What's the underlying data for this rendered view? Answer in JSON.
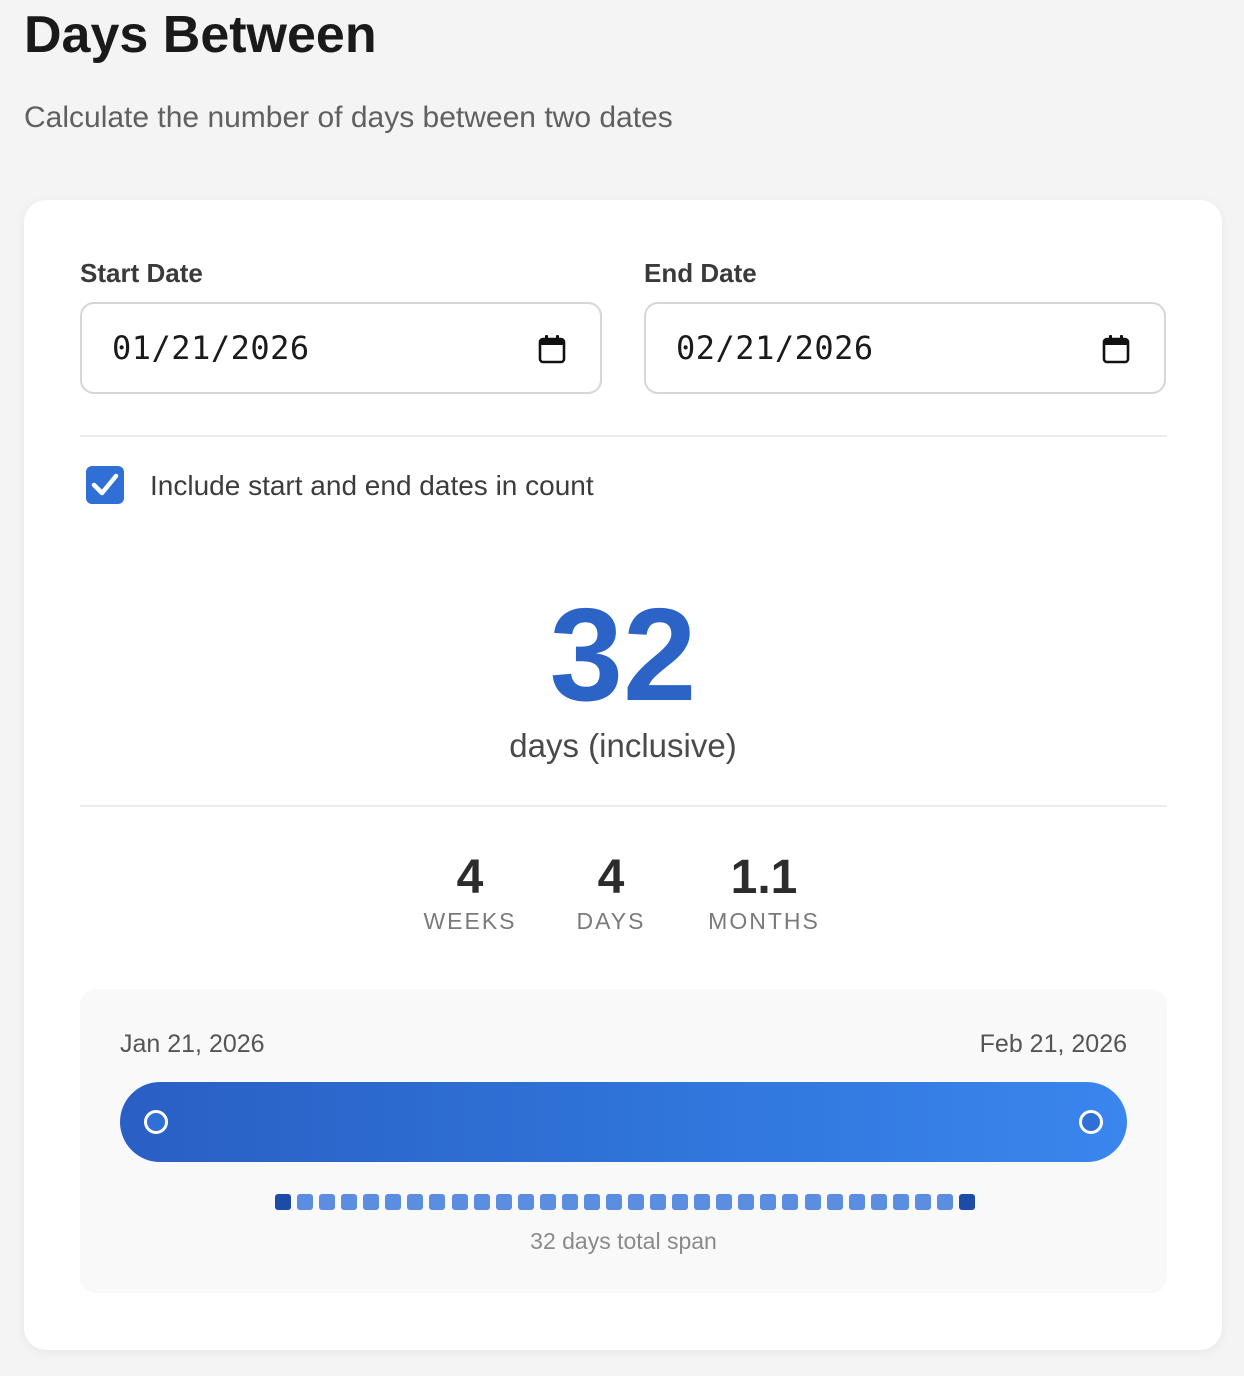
{
  "page": {
    "title": "Days Between",
    "subtitle": "Calculate the number of days between two dates"
  },
  "form": {
    "start_label": "Start Date",
    "start_value": "01/21/2026",
    "end_label": "End Date",
    "end_value": "02/21/2026",
    "calendar_icon": "calendar-icon"
  },
  "options": {
    "include_label": "Include start and end dates in count",
    "include_checked": true
  },
  "result": {
    "total_days": "32",
    "caption": "days (inclusive)",
    "breakdown": [
      {
        "value": "4",
        "label": "WEEKS"
      },
      {
        "value": "4",
        "label": "DAYS"
      },
      {
        "value": "1.1",
        "label": "MONTHS"
      }
    ]
  },
  "timeline": {
    "start_label": "Jan 21, 2026",
    "end_label": "Feb 21, 2026",
    "day_count": 32,
    "caption": "32 days total span"
  },
  "colors": {
    "accent": "#2b63c6",
    "checkbox": "#2f6fd6",
    "square": "#5b8ee0",
    "square_edge": "#1c4ca8"
  }
}
